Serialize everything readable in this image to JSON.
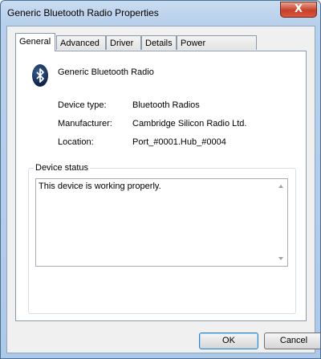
{
  "window": {
    "title": "Generic Bluetooth Radio Properties",
    "close_label": "X"
  },
  "tabs": [
    {
      "label": "General",
      "active": true
    },
    {
      "label": "Advanced"
    },
    {
      "label": "Driver"
    },
    {
      "label": "Details"
    },
    {
      "label": "Power Management"
    }
  ],
  "device": {
    "icon": "bluetooth-icon",
    "name": "Generic Bluetooth Radio",
    "properties": [
      {
        "label": "Device type:",
        "value": "Bluetooth Radios"
      },
      {
        "label": "Manufacturer:",
        "value": "Cambridge Silicon Radio Ltd."
      },
      {
        "label": "Location:",
        "value": "Port_#0001.Hub_#0004"
      }
    ]
  },
  "status": {
    "legend": "Device status",
    "text": "This device is working properly."
  },
  "buttons": {
    "ok": "OK",
    "cancel": "Cancel"
  }
}
